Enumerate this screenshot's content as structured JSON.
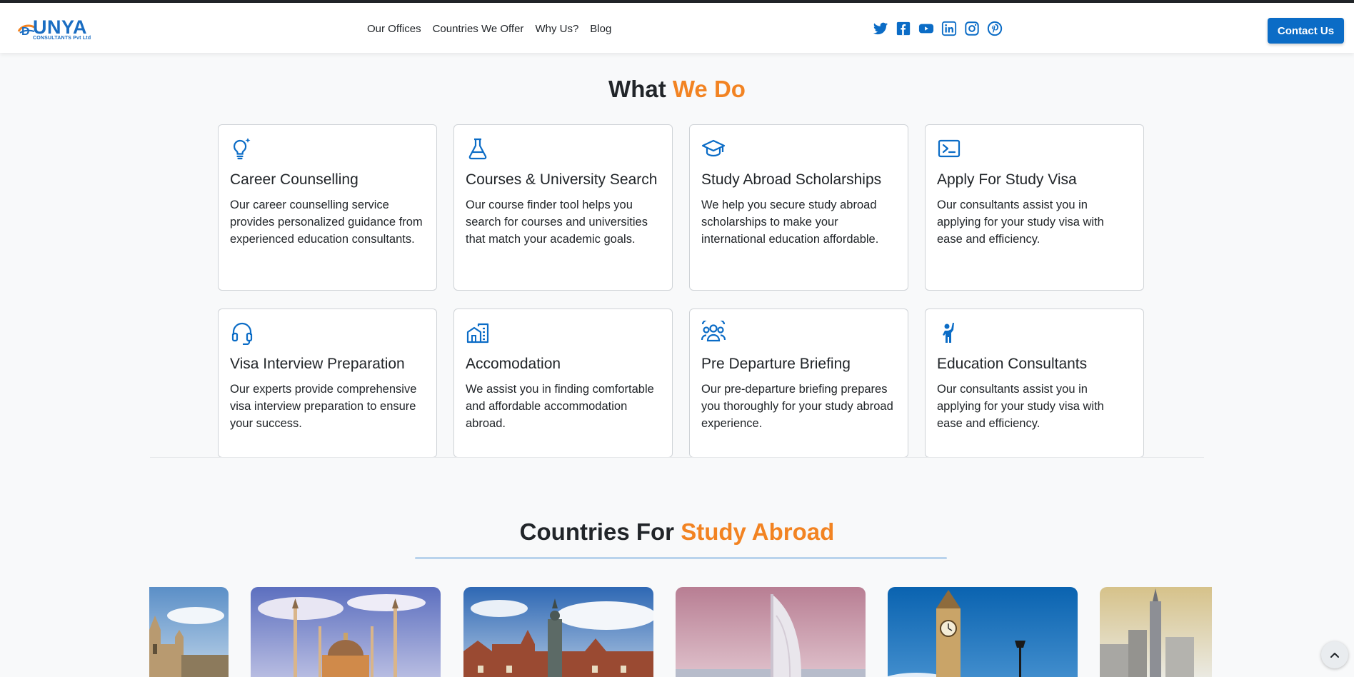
{
  "header": {
    "logo": {
      "brand": "UNYA",
      "subtitle": "CONSULTANTS Pvt Ltd"
    },
    "nav": [
      "Our Offices",
      "Countries We Offer",
      "Why Us?",
      "Blog"
    ],
    "socials": [
      "twitter-icon",
      "facebook-icon",
      "youtube-icon",
      "linkedin-icon",
      "instagram-icon",
      "pinterest-icon"
    ],
    "contact_label": "Contact Us"
  },
  "what_we_do": {
    "title_main": "What",
    "title_accent": "We Do",
    "cards": [
      {
        "icon": "lightbulb-icon",
        "title": "Career Counselling",
        "text": "Our career counselling service provides personalized guidance from experienced education consultants."
      },
      {
        "icon": "flask-icon",
        "title": "Courses & University Search",
        "text": "Our course finder tool helps you search for courses and universities that match your academic goals."
      },
      {
        "icon": "mortarboard-icon",
        "title": "Study Abroad Scholarships",
        "text": "We help you secure study abroad scholarships to make your international education affordable."
      },
      {
        "icon": "terminal-icon",
        "title": "Apply For Study Visa",
        "text": "Our consultants assist you in applying for your study visa with ease and efficiency."
      },
      {
        "icon": "headphones-icon",
        "title": "Visa Interview Preparation",
        "text": "Our experts provide comprehensive visa interview preparation to ensure your success."
      },
      {
        "icon": "buildings-icon",
        "title": "Accomodation",
        "text": "We assist you in finding comfortable and affordable accommodation abroad."
      },
      {
        "icon": "people-icon",
        "title": "Pre Departure Briefing",
        "text": "Our pre-departure briefing prepares you thoroughly for your study abroad experience."
      },
      {
        "icon": "person-raised-hand-icon",
        "title": "Education Consultants",
        "text": "Our consultants assist you in applying for your study visa with ease and efficiency."
      }
    ]
  },
  "countries": {
    "title_main": "Countries For",
    "title_accent": "Study Abroad"
  },
  "colors": {
    "accent": "#f28322",
    "brand": "#0b6cc6"
  }
}
